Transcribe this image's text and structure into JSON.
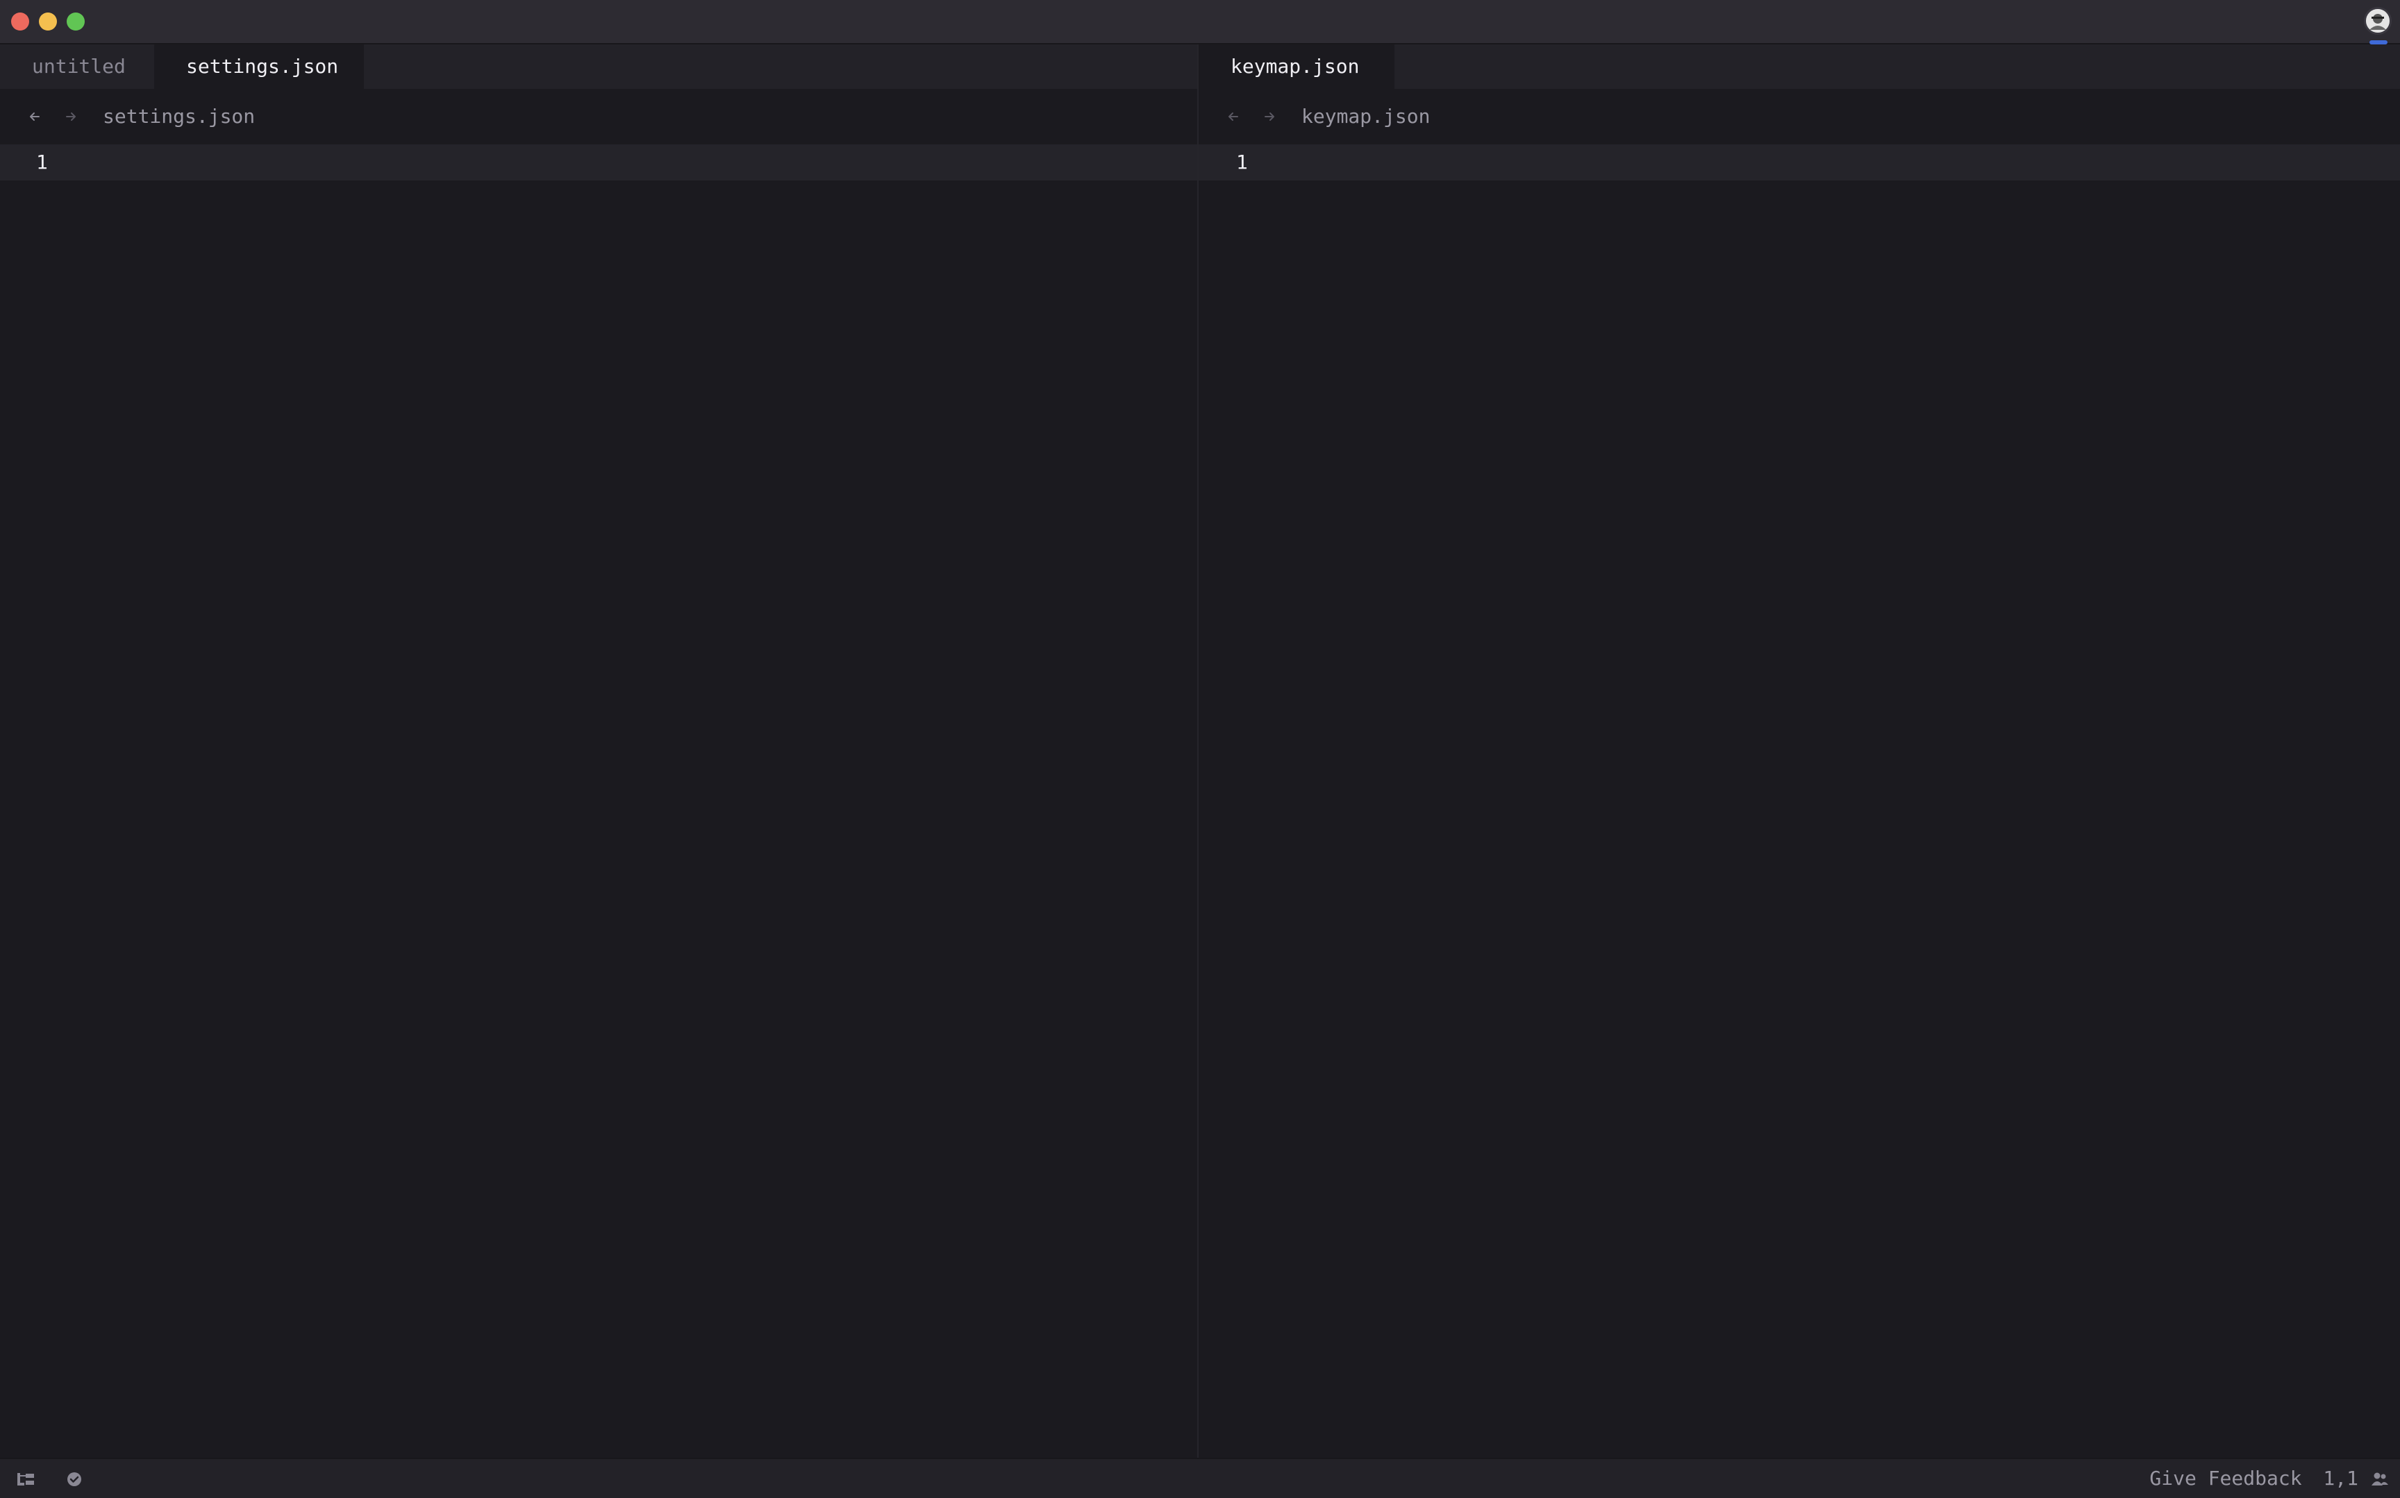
{
  "colors": {
    "background": "#1b1a1f",
    "titlebar": "#2d2b32",
    "tabbar": "#232228",
    "current_line": "#25242a",
    "text_active": "#f0eff4",
    "text_muted": "#8a8894",
    "traffic_close": "#ed6a5e",
    "traffic_minimize": "#f4bf4f",
    "traffic_maximize": "#61c554",
    "accent": "#3f6ad8"
  },
  "left_pane": {
    "tabs": [
      {
        "label": "untitled",
        "active": false
      },
      {
        "label": "settings.json",
        "active": true
      }
    ],
    "breadcrumb": "settings.json",
    "line_numbers": [
      "1"
    ]
  },
  "right_pane": {
    "tabs": [
      {
        "label": "keymap.json",
        "active": true
      }
    ],
    "breadcrumb": "keymap.json",
    "line_numbers": [
      "1"
    ]
  },
  "statusbar": {
    "feedback_label": "Give Feedback",
    "cursor_position": "1,1",
    "left_icons": [
      "project-panel-icon",
      "diagnostics-check-icon"
    ],
    "right_icons": [
      "collaborators-icon"
    ]
  }
}
